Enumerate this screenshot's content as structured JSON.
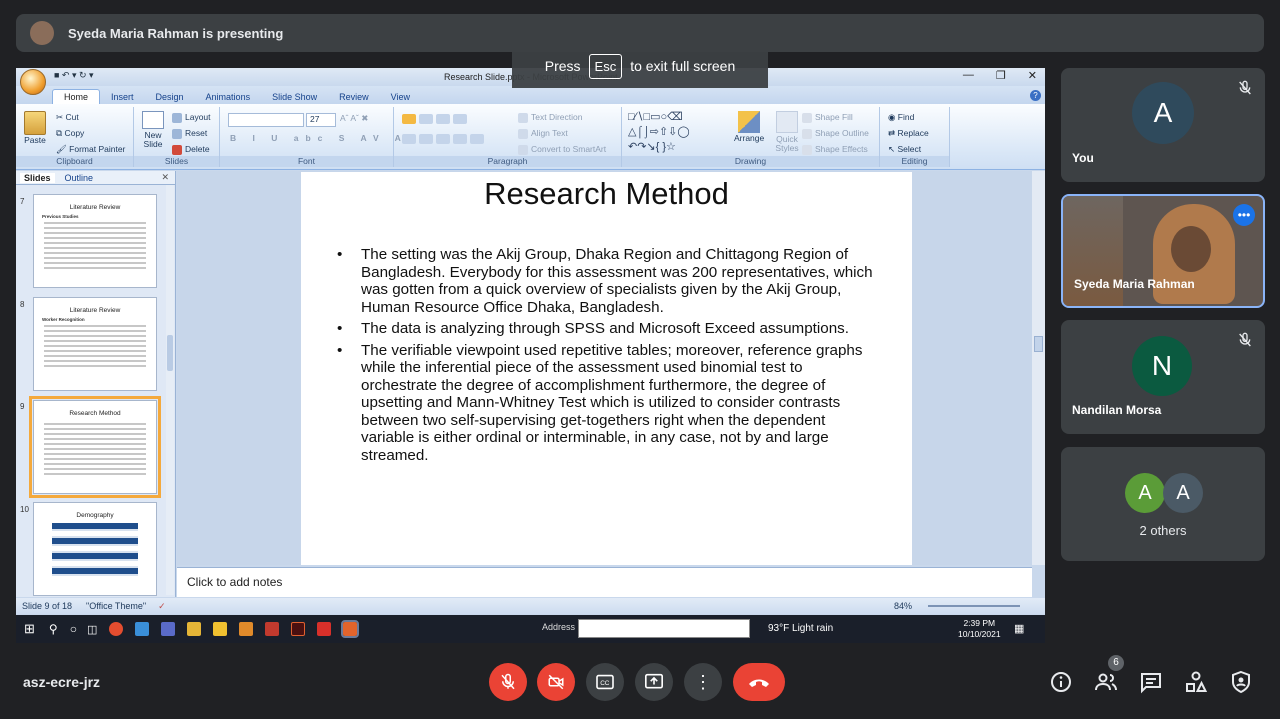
{
  "presenting_banner": {
    "text": "Syeda Maria Rahman is presenting",
    "avatar_initial": ""
  },
  "fullscreen_tip": {
    "prefix": "Press",
    "key": "Esc",
    "suffix": "to exit full screen"
  },
  "ppt": {
    "window_title": "Research Slide.pptx - Microsoft PowerPoint",
    "tabs": [
      "Home",
      "Insert",
      "Design",
      "Animations",
      "Slide Show",
      "Review",
      "View"
    ],
    "active_tab": "Home",
    "ribbon": {
      "clipboard": {
        "label": "Clipboard",
        "paste": "Paste",
        "cut": "Cut",
        "copy": "Copy",
        "format_painter": "Format Painter"
      },
      "slides": {
        "label": "Slides",
        "new_slide": "New Slide",
        "layout": "Layout",
        "reset": "Reset",
        "delete": "Delete"
      },
      "font": {
        "label": "Font",
        "size": "27"
      },
      "paragraph": {
        "label": "Paragraph",
        "text_direction": "Text Direction",
        "align_text": "Align Text",
        "convert_smartart": "Convert to SmartArt"
      },
      "drawing": {
        "label": "Drawing",
        "arrange": "Arrange",
        "quick_styles": "Quick Styles",
        "shape_fill": "Shape Fill",
        "shape_outline": "Shape Outline",
        "shape_effects": "Shape Effects"
      },
      "editing": {
        "label": "Editing",
        "find": "Find",
        "replace": "Replace",
        "select": "Select"
      }
    },
    "panel_tabs": [
      "Slides",
      "Outline"
    ],
    "thumbnails": [
      {
        "num": "7",
        "title": "Literature Review",
        "subtitle": "Previous Studies"
      },
      {
        "num": "8",
        "title": "Literature Review",
        "subtitle": "Worker Recognition"
      },
      {
        "num": "9",
        "title": "Research Method",
        "subtitle": ""
      },
      {
        "num": "10",
        "title": "Demography",
        "subtitle": ""
      }
    ],
    "slide": {
      "title": "Research Method",
      "bullets": [
        "The setting was the Akij Group, Dhaka Region and Chittagong Region of Bangladesh. Everybody for this assessment was 200 representatives, which was gotten from a quick overview of specialists given by the Akij Group, Human Resource Office Dhaka, Bangladesh.",
        "The data is analyzing through SPSS and Microsoft Exceed assumptions.",
        "The verifiable viewpoint used repetitive tables; moreover, reference graphs while the inferential piece of the assessment used binomial test to orchestrate the degree of accomplishment furthermore, the degree of upsetting and Mann-Whitney Test which is utilized to consider contrasts between two self-supervising get-togethers right when the dependent variable is either ordinal or interminable, in any case, not by and large streamed."
      ]
    },
    "notes_placeholder": "Click to add notes",
    "status": {
      "slide_counter": "Slide 9 of 18",
      "theme": "\"Office Theme\"",
      "zoom": "84%"
    }
  },
  "taskbar": {
    "address_label": "Address",
    "weather": "93°F  Light rain",
    "time": "2:39 PM",
    "date": "10/10/2021"
  },
  "participants": [
    {
      "name": "You",
      "initial": "A",
      "color": "#2f4a5c"
    },
    {
      "name": "Syeda Maria Rahman"
    },
    {
      "name": "Nandilan Morsa",
      "initial": "N",
      "color": "#0b5a40"
    },
    {
      "name": "2 others",
      "initials": [
        "A",
        "A"
      ],
      "colors": [
        "#5b9c38",
        "#4b5a66"
      ]
    }
  ],
  "bottom_bar": {
    "meeting_code": "asz-ecre-jrz",
    "participant_count": "6"
  }
}
